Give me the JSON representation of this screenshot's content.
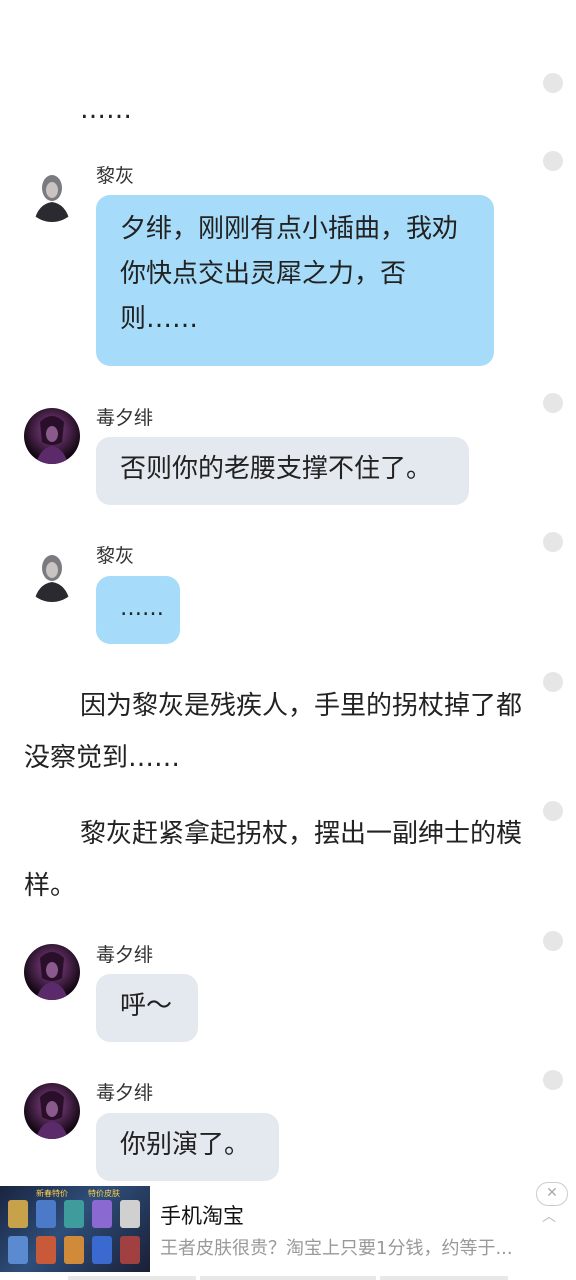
{
  "messages": [
    {
      "type": "narration",
      "text": "……"
    },
    {
      "type": "chat",
      "speaker": "黎灰",
      "text": "夕绯，刚刚有点小插曲，我劝你快点交出灵犀之力，否则……"
    },
    {
      "type": "chat",
      "speaker": "毒夕绯",
      "text": "否则你的老腰支撑不住了。"
    },
    {
      "type": "chat",
      "speaker": "黎灰",
      "text": "……"
    },
    {
      "type": "narration",
      "text": "因为黎灰是残疾人，手里的拐杖掉了都没察觉到……"
    },
    {
      "type": "narration",
      "text": "黎灰赶紧拿起拐杖，摆出一副绅士的模样。"
    },
    {
      "type": "chat",
      "speaker": "毒夕绯",
      "text": "呼～"
    },
    {
      "type": "chat",
      "speaker": "毒夕绯",
      "text": "你别演了。"
    }
  ],
  "ad": {
    "title": "手机淘宝",
    "description": "王者皮肤很贵？淘宝上只要1分钱，约等于...",
    "thumb_labels": [
      "新春特价",
      "特价皮肤"
    ],
    "close_symbol": "✕",
    "caret_symbol": "︿"
  },
  "icons": {
    "avatar": "character-avatar-icon",
    "more": "comment-dot-icon",
    "close": "close-icon",
    "caret": "chevron-up-icon"
  },
  "colors": {
    "bubble_blue": "#a6dcf9",
    "bubble_gray": "#e4e8ef",
    "dot": "#e6e6e6"
  }
}
